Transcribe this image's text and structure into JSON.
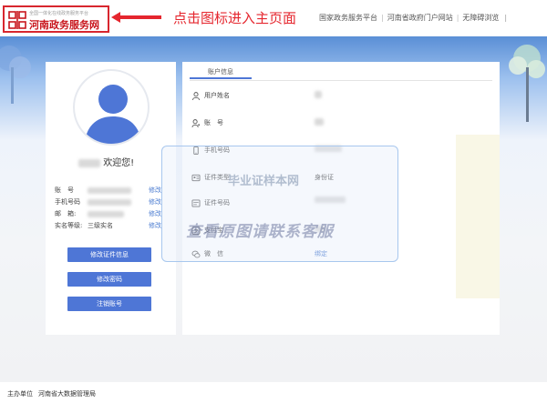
{
  "header": {
    "logo_subtitle": "全国一体化在线政务服务平台",
    "logo_title": "河南政务服务网",
    "annotation": "点击图标进入主页面",
    "top_links": [
      "国家政务服务平台",
      "河南省政府门户网站",
      "无障碍浏览"
    ]
  },
  "profile": {
    "welcome": "欢迎您!",
    "rows": [
      {
        "label": "账　号",
        "edit": "修改"
      },
      {
        "label": "手机号码",
        "edit": "修改"
      },
      {
        "label": "邮　箱:",
        "edit": "修改"
      },
      {
        "label": "实名等级:",
        "value": "三级实名",
        "edit": "修改"
      }
    ],
    "buttons": [
      "修改证件信息",
      "修改密码",
      "注销账号"
    ]
  },
  "account": {
    "tab": "账户信息",
    "fields": [
      {
        "label": "用户姓名",
        "icon": "user-icon"
      },
      {
        "label": "账　号",
        "icon": "user-key-icon"
      },
      {
        "label": "手机号码",
        "icon": "phone-icon"
      },
      {
        "label": "证件类型",
        "value": "身份证",
        "icon": "id-card-icon"
      },
      {
        "label": "证件号码",
        "icon": "id-number-icon"
      },
      {
        "label": "支付宝",
        "icon": "alipay-icon"
      },
      {
        "label": "微　信",
        "link": "绑定",
        "icon": "wechat-icon"
      }
    ]
  },
  "watermark": {
    "line1": "毕业证样本网",
    "line2": "查看原图请联系客服"
  },
  "footer": {
    "label": "主办单位",
    "value": "河南省大数据管理局"
  },
  "colors": {
    "brand_red": "#c8161d",
    "primary_blue": "#4e76d6",
    "link_blue": "#4a7bd0"
  }
}
